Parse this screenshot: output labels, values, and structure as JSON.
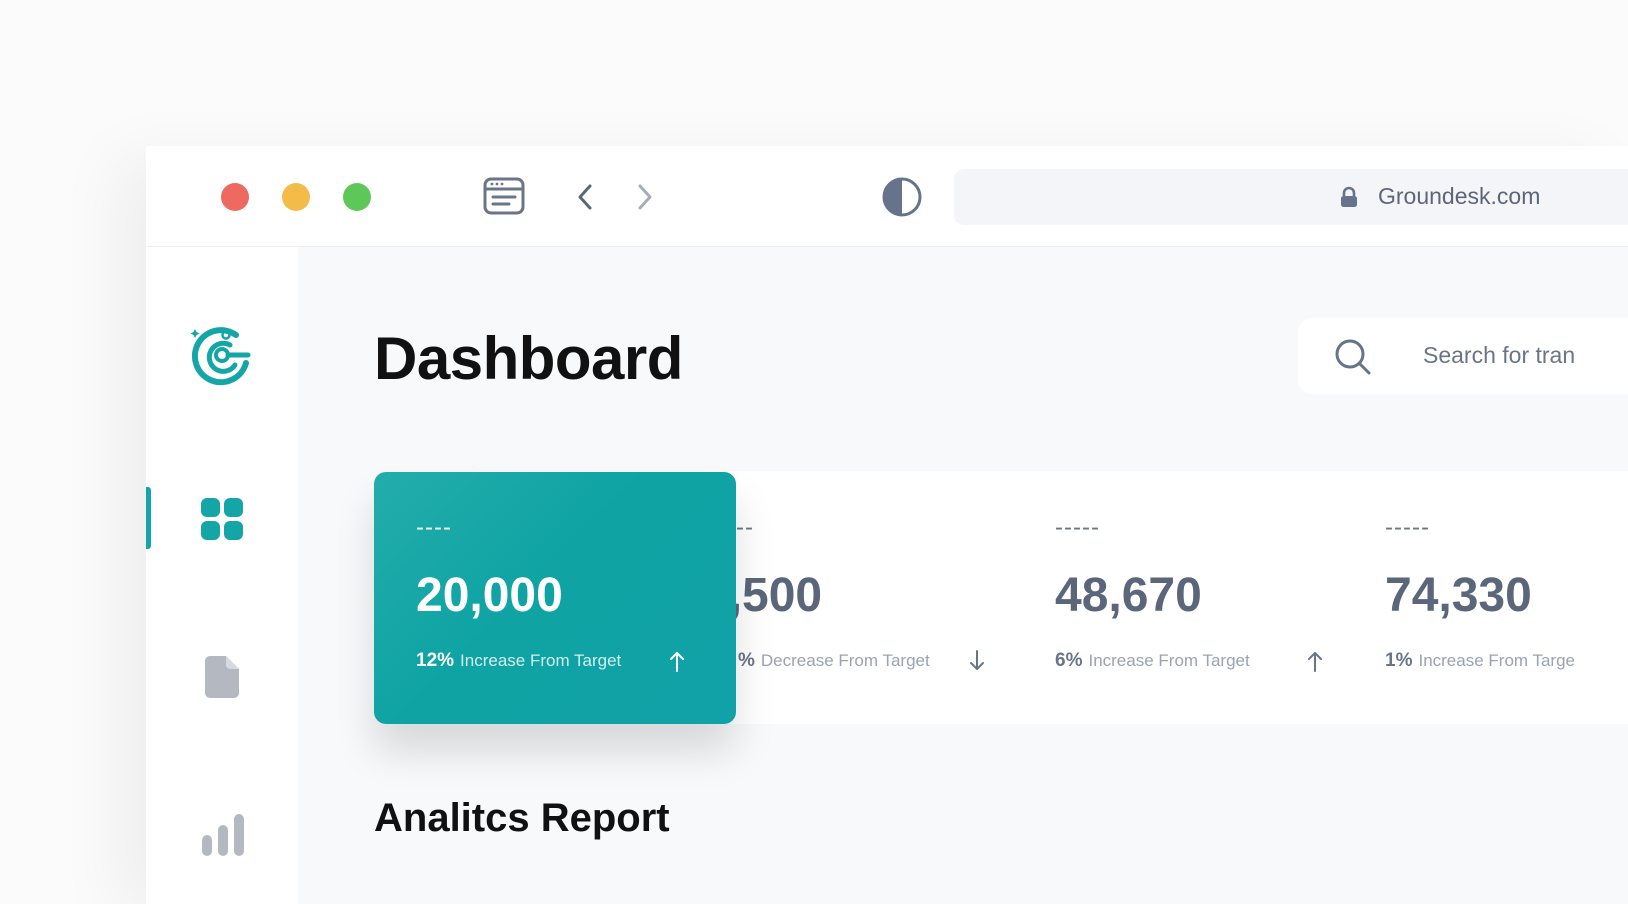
{
  "browser": {
    "url": "Groundesk.com"
  },
  "header": {
    "title": "Dashboard",
    "search_placeholder": "Search for tran"
  },
  "sidebar": {
    "items": [
      {
        "icon": "grid-icon",
        "active": true
      },
      {
        "icon": "document-icon",
        "active": false
      },
      {
        "icon": "bar-chart-icon",
        "active": false
      }
    ]
  },
  "stats": [
    {
      "label": "----",
      "value": "20,000",
      "percent": "12%",
      "change": "Increase From Target",
      "direction": "up"
    },
    {
      "label": "----",
      "value": "6,500",
      "percent": "%",
      "change": "Decrease From Target",
      "direction": "down"
    },
    {
      "label": "-----",
      "value": "48,670",
      "percent": "6%",
      "change": "Increase From Target",
      "direction": "up"
    },
    {
      "label": "-----",
      "value": "74,330",
      "percent": "1%",
      "change": "Increase From Targe",
      "direction": "up"
    }
  ],
  "section": {
    "title": "Analitcs Report"
  },
  "colors": {
    "accent": "#14a6a6",
    "traffic_red": "#ee6a60",
    "traffic_yellow": "#f3bc49",
    "traffic_green": "#5dc75a",
    "muted_text": "#5b667a"
  }
}
